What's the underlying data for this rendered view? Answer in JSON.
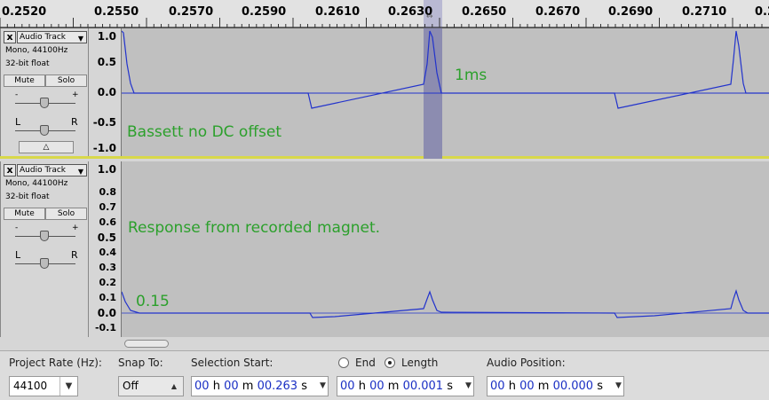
{
  "ruler": {
    "ticks": [
      "0.2520",
      "0.2550",
      "0.2570",
      "0.2590",
      "0.2610",
      "0.2630",
      "0.2650",
      "0.2670",
      "0.2690",
      "0.2710",
      "0.2"
    ]
  },
  "tracks": [
    {
      "close": "x",
      "name": "Audio Track",
      "format": "Mono, 44100Hz",
      "bits": "32-bit float",
      "mute": "Mute",
      "solo": "Solo",
      "gain_minus": "-",
      "gain_plus": "+",
      "pan_left": "L",
      "pan_right": "R",
      "scale": [
        "1.0",
        "0.5",
        "0.0",
        "-0.5",
        "-1.0"
      ],
      "label": "Bassett no DC offset",
      "annotation": "1ms"
    },
    {
      "close": "x",
      "name": "Audio Track",
      "format": "Mono, 44100Hz",
      "bits": "32-bit float",
      "mute": "Mute",
      "solo": "Solo",
      "gain_minus": "-",
      "gain_plus": "+",
      "pan_left": "L",
      "pan_right": "R",
      "scale": [
        "1.0",
        "0.8",
        "0.7",
        "0.6",
        "0.5",
        "0.4",
        "0.3",
        "0.2",
        "0.1",
        "0.0",
        "-0.1"
      ],
      "label": "Response from recorded magnet.",
      "annotation": "0.15"
    }
  ],
  "toolbar": {
    "project_rate_label": "Project Rate (Hz):",
    "project_rate_value": "44100",
    "snap_to_label": "Snap To:",
    "snap_to_value": "Off",
    "selection_start_label": "Selection Start:",
    "selection_start": {
      "h": "00",
      "m": "00",
      "s": "00.263"
    },
    "end_label": "End",
    "length_label": "Length",
    "selected_mode": "Length",
    "length_value": {
      "h": "00",
      "m": "00",
      "s": "00.001"
    },
    "audio_position_label": "Audio Position:",
    "audio_position": {
      "h": "00",
      "m": "00",
      "s": "00.000"
    },
    "unit_h": "h",
    "unit_m": "m",
    "unit_s": "s"
  },
  "colors": {
    "waveform": "#2233cc",
    "label_text": "#2ca02c",
    "selection": "#8c8cb0",
    "track_bg": "#c0c0c0"
  }
}
